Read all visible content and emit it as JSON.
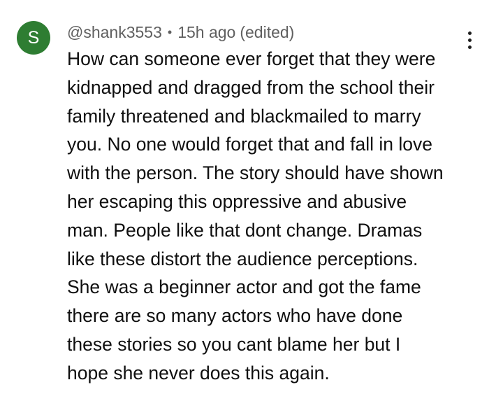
{
  "comment": {
    "avatar_letter": "S",
    "avatar_color": "#2e7d32",
    "author": "@shank3553",
    "separator": "•",
    "time": "15h ago",
    "edited": "(edited)",
    "menu_icon": "more-vertical-icon",
    "lines": [
      "How can someone ever forget that they were",
      "kidnapped and dragged from the school their",
      "family threatened and blackmailed to marry",
      "you. No one would forget that and fall in love",
      "with the person. The story should have shown",
      "her escaping this oppressive and abusive",
      "man. People like that dont change. Dramas",
      "like these distort the audience perceptions.",
      "She was a beginner actor and got the fame",
      "there are so many actors who have done",
      "these stories so you cant blame her but I",
      "hope she never does this again."
    ]
  }
}
